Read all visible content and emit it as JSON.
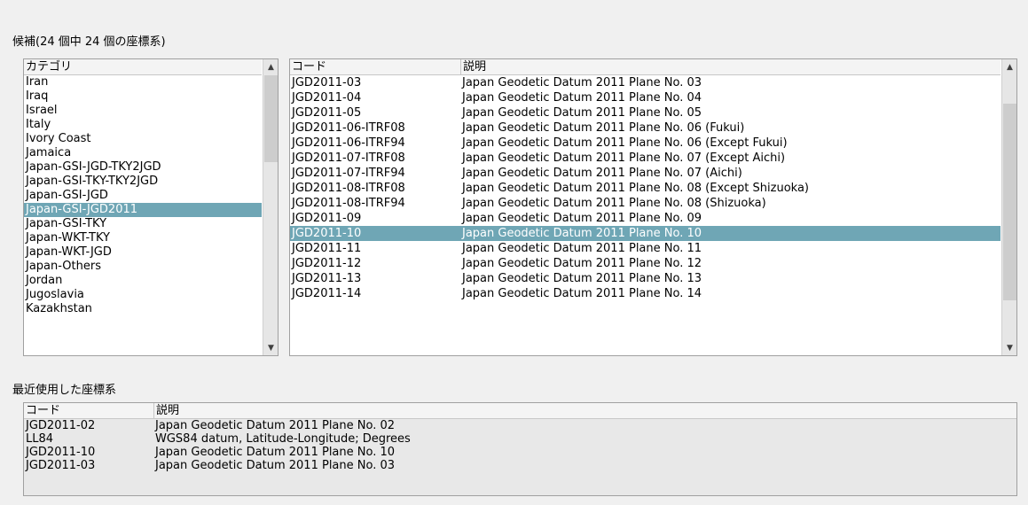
{
  "candidates_caption": "候補(24 個中 24 個の座標系)",
  "categories": {
    "header": "カテゴリ",
    "items": [
      "Iran",
      "Iraq",
      "Israel",
      "Italy",
      "Ivory Coast",
      "Jamaica",
      "Japan-GSI-JGD-TKY2JGD",
      "Japan-GSI-TKY-TKY2JGD",
      "Japan-GSI-JGD",
      "Japan-GSI-JGD2011",
      "Japan-GSI-TKY",
      "Japan-WKT-TKY",
      "Japan-WKT-JGD",
      "Japan-Others",
      "Jordan",
      "Jugoslavia",
      "Kazakhstan"
    ],
    "selected": "Japan-GSI-JGD2011"
  },
  "systems": {
    "header_code": "コード",
    "header_desc": "説明",
    "rows": [
      {
        "code": "JGD2011-03",
        "desc": "Japan Geodetic Datum 2011 Plane No. 03"
      },
      {
        "code": "JGD2011-04",
        "desc": "Japan Geodetic Datum 2011 Plane No. 04"
      },
      {
        "code": "JGD2011-05",
        "desc": "Japan Geodetic Datum 2011 Plane No. 05"
      },
      {
        "code": "JGD2011-06-ITRF08",
        "desc": "Japan Geodetic Datum 2011 Plane No. 06 (Fukui)"
      },
      {
        "code": "JGD2011-06-ITRF94",
        "desc": "Japan Geodetic Datum 2011 Plane No. 06 (Except Fukui)"
      },
      {
        "code": "JGD2011-07-ITRF08",
        "desc": "Japan Geodetic Datum 2011 Plane No. 07 (Except Aichi)"
      },
      {
        "code": "JGD2011-07-ITRF94",
        "desc": "Japan Geodetic Datum 2011 Plane No. 07 (Aichi)"
      },
      {
        "code": "JGD2011-08-ITRF08",
        "desc": "Japan Geodetic Datum 2011 Plane No. 08 (Except Shizuoka)"
      },
      {
        "code": "JGD2011-08-ITRF94",
        "desc": "Japan Geodetic Datum 2011 Plane No. 08 (Shizuoka)"
      },
      {
        "code": "JGD2011-09",
        "desc": "Japan Geodetic Datum 2011 Plane No. 09"
      },
      {
        "code": "JGD2011-10",
        "desc": "Japan Geodetic Datum 2011 Plane No. 10"
      },
      {
        "code": "JGD2011-11",
        "desc": "Japan Geodetic Datum 2011 Plane No. 11"
      },
      {
        "code": "JGD2011-12",
        "desc": "Japan Geodetic Datum 2011 Plane No. 12"
      },
      {
        "code": "JGD2011-13",
        "desc": "Japan Geodetic Datum 2011 Plane No. 13"
      },
      {
        "code": "JGD2011-14",
        "desc": "Japan Geodetic Datum 2011 Plane No. 14"
      }
    ],
    "selected": "JGD2011-10"
  },
  "recent_caption": "最近使用した座標系",
  "recent": {
    "header_code": "コード",
    "header_desc": "説明",
    "rows": [
      {
        "code": "JGD2011-02",
        "desc": "Japan Geodetic Datum 2011 Plane No. 02"
      },
      {
        "code": "LL84",
        "desc": "WGS84 datum, Latitude-Longitude; Degrees"
      },
      {
        "code": "JGD2011-10",
        "desc": "Japan Geodetic Datum 2011 Plane No. 10"
      },
      {
        "code": "JGD2011-03",
        "desc": "Japan Geodetic Datum 2011 Plane No. 03"
      }
    ]
  },
  "icons": {
    "scroll_up": "triangle-up-icon",
    "scroll_down": "triangle-down-icon"
  },
  "colors": {
    "selection": "#6fa6b5",
    "background": "#f0f0f0"
  }
}
